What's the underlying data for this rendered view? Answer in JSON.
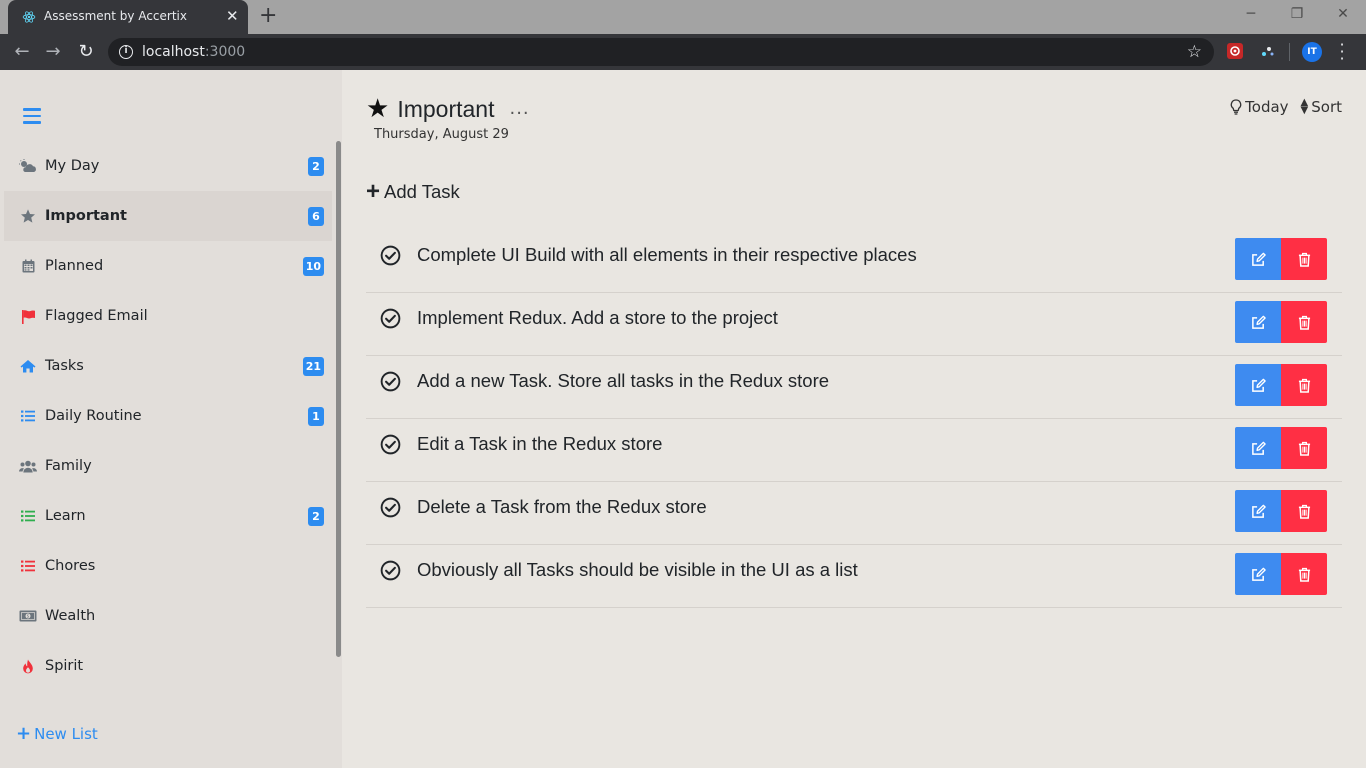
{
  "browser": {
    "tab_title": "Assessment by Accertix",
    "tab_close": "✕",
    "new_tab": "+",
    "url_host": "localhost",
    "url_port": ":3000",
    "profile_initials": "IT"
  },
  "sidebar": {
    "items": [
      {
        "label": "My Day",
        "icon": "cloud-sun-icon",
        "badge": "2",
        "active": false
      },
      {
        "label": "Important",
        "icon": "star-icon",
        "badge": "6",
        "active": true
      },
      {
        "label": "Planned",
        "icon": "calendar-icon",
        "badge": "10",
        "active": false
      },
      {
        "label": "Flagged Email",
        "icon": "flag-icon",
        "badge": "",
        "active": false
      },
      {
        "label": "Tasks",
        "icon": "home-icon",
        "badge": "21",
        "active": false
      },
      {
        "label": "Daily Routine",
        "icon": "list-icon",
        "badge": "1",
        "active": false
      },
      {
        "label": "Family",
        "icon": "users-icon",
        "badge": "",
        "active": false
      },
      {
        "label": "Learn",
        "icon": "list-icon",
        "badge": "2",
        "active": false
      },
      {
        "label": "Chores",
        "icon": "list-icon",
        "badge": "",
        "active": false
      },
      {
        "label": "Wealth",
        "icon": "money-bill-icon",
        "badge": "",
        "active": false
      },
      {
        "label": "Spirit",
        "icon": "fire-icon",
        "badge": "",
        "active": false
      }
    ],
    "new_list_label": "New List"
  },
  "main": {
    "title": "Important",
    "more": "...",
    "date": "Thursday, August 29",
    "today_label": "Today",
    "sort_label": "Sort",
    "add_task_label": "Add Task",
    "tasks": [
      "Complete UI Build with all elements in their respective places",
      "Implement Redux. Add a store to the project",
      "Add a new Task. Store all tasks in the Redux store",
      "Edit a Task in the Redux store",
      "Delete a Task from the Redux store",
      "Obviously all Tasks should be visible in the UI as a list"
    ]
  },
  "colors": {
    "accent_blue": "#2d8cf0",
    "edit_button": "#3e8bf0",
    "delete_button": "#ff2f44",
    "sidebar_bg": "#e2deda",
    "main_bg": "#e9e6e1"
  }
}
